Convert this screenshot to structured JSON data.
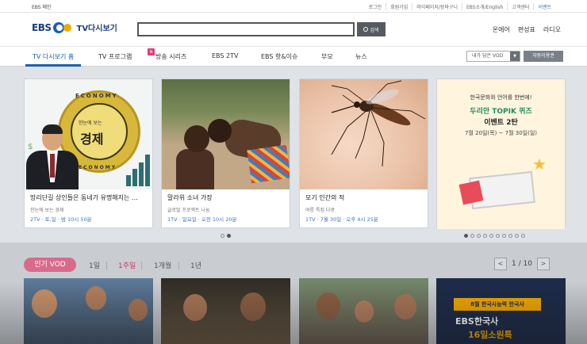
{
  "utilbar": {
    "ebs_home": "EBS 메인",
    "links": [
      "로그인",
      "회원가입",
      "마이페이지/장바구니",
      "EBS소개/English",
      "고객센터",
      "이벤트"
    ]
  },
  "header": {
    "logo_ebs": "EBS",
    "logo_tv": "TV다시보기",
    "search_placeholder": "",
    "search_button": "검색",
    "quick_links": [
      "온에어",
      "편성표",
      "라디오"
    ]
  },
  "nav": {
    "items": [
      "TV 다시보기 홈",
      "TV 프로그램",
      "방송 시리즈",
      "EBS 2TV",
      "EBS 핫&이슈",
      "부모",
      "뉴스"
    ],
    "badge": "N",
    "vod_select": "내가 담은 VOD",
    "vod_button": "자동이용권"
  },
  "featured": [
    {
      "title": "망리단길 상인들은 동네가 유명해지는 …",
      "sub": "한눈에 보는 경제",
      "meta": "2TV · 토,일 · 밤 10시 50분"
    },
    {
      "title": "말라위 소녀 가장",
      "sub": "글로벌 프로젝트 나눔",
      "meta": "1TV · 일요일 · 오전 10시 20분"
    },
    {
      "title": "모기 인간의 적",
      "sub": "여름 특집 다큐",
      "meta": "1TV · 7월 30일 · 오후 4시 25분"
    }
  ],
  "thumb1": {
    "ring_top": "ECONOMY",
    "ring_bottom": "ECONOMY",
    "coin_small": "한눈에 보는",
    "coin_big": "경제"
  },
  "ad": {
    "line1": "한국문화와 언어를 한번에!",
    "line2": "두리안 TOPIK 퀴즈",
    "line3": "이벤트 2탄",
    "line4": "7월 20일(목) ~ 7월 30일(일)"
  },
  "popular": {
    "label": "인기 VOD",
    "periods": [
      "1일",
      "1주일",
      "1개월",
      "1년"
    ],
    "active_period": "1주일",
    "page": "1 / 10",
    "prev": "<",
    "next": ">"
  },
  "vod4": {
    "line1": "8월 한국사능력 한국사",
    "line2": "EBS한국사",
    "line3": "16일소원특"
  },
  "colors": {
    "brand_blue": "#1a5fb4",
    "accent_pink": "#d96a8b",
    "meta_blue": "#3d73c5"
  },
  "slider": {
    "total_dots": 2,
    "active_dot": 2
  },
  "ad_slider": {
    "total_dots": 10,
    "active_dot": 1
  }
}
